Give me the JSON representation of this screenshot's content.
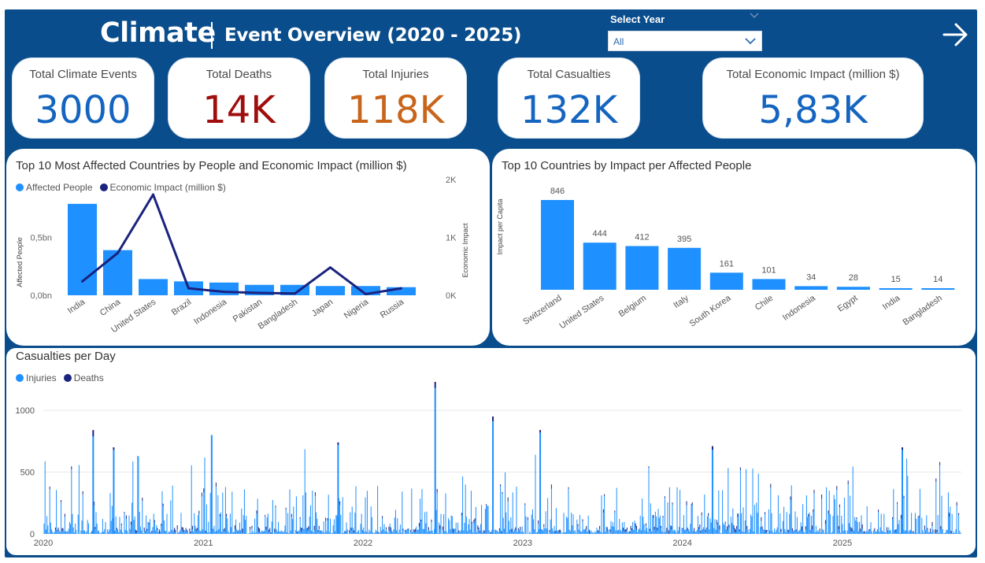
{
  "header": {
    "title": "Climate",
    "subtitle": "Event Overview (2020 - 2025)",
    "filter_label": "Select Year",
    "filter_value": "All",
    "nav_icon": "arrow-right-icon"
  },
  "colors": {
    "background": "#0a4d8c",
    "primary_bar": "#1e90ff",
    "dark_series": "#1a237e",
    "deaths_value": "#a00d0d",
    "injuries_value": "#c8651b",
    "blue_value": "#1565c0"
  },
  "kpis": [
    {
      "label": "Total Climate Events",
      "value": "3000",
      "color": "#1565c0"
    },
    {
      "label": "Total Deaths",
      "value": "14K",
      "color": "#a00d0d"
    },
    {
      "label": "Total Injuries",
      "value": "118K",
      "color": "#c8651b"
    },
    {
      "label": "Total Casualties",
      "value": "132K",
      "color": "#1565c0"
    },
    {
      "label": "Total Economic Impact (million $)",
      "value": "5,83K",
      "color": "#1565c0"
    }
  ],
  "chart_data": [
    {
      "type": "bar",
      "title": "Top 10 Most Affected Countries by People and Economic Impact (million $)",
      "categories": [
        "India",
        "China",
        "United States",
        "Brazil",
        "Indonesia",
        "Pakistan",
        "Bangladesh",
        "Japan",
        "Nigeria",
        "Russia"
      ],
      "series": [
        {
          "name": "Affected People",
          "type": "bar",
          "axis": "left",
          "values": [
            0.79,
            0.39,
            0.14,
            0.12,
            0.11,
            0.09,
            0.09,
            0.08,
            0.08,
            0.07
          ]
        },
        {
          "name": "Economic Impact (million $)",
          "type": "line",
          "axis": "right",
          "values": [
            240,
            730,
            1740,
            120,
            60,
            40,
            30,
            480,
            20,
            120
          ]
        }
      ],
      "ylabel": "Affected People",
      "ylabel_right": "Economic Impact",
      "y_ticks": [
        "0,0bn",
        "0,5bn"
      ],
      "y2_ticks": [
        "0K",
        "1K",
        "2K"
      ],
      "ylim": [
        0,
        1.0
      ],
      "y2lim": [
        0,
        2000
      ],
      "legend": "top-left"
    },
    {
      "type": "bar",
      "title": "Top 10 Countries by Impact per Affected People",
      "categories": [
        "Switzerland",
        "United States",
        "Belgium",
        "Italy",
        "South Korea",
        "Chile",
        "Indonesia",
        "Egypt",
        "India",
        "Bangladesh"
      ],
      "values": [
        846,
        444,
        412,
        395,
        161,
        101,
        34,
        28,
        15,
        14
      ],
      "ylabel": "Impact per Capita",
      "ylim": [
        0,
        846
      ]
    },
    {
      "type": "bar",
      "title": "Casualties per Day",
      "x_ticks": [
        "2020",
        "2021",
        "2022",
        "2023",
        "2024",
        "2025"
      ],
      "y_ticks": [
        "0",
        "500",
        "1000"
      ],
      "ylim": [
        0,
        1300
      ],
      "xlim": [
        "2020-01-01",
        "2025-09-30"
      ],
      "legend": "top-left",
      "series": [
        {
          "name": "Injuries",
          "color": "#1e90ff"
        },
        {
          "name": "Deaths",
          "color": "#1a237e"
        }
      ],
      "notable_peaks": [
        {
          "x": "2020-04-24",
          "injuries": 790,
          "deaths": 50
        },
        {
          "x": "2020-06-10",
          "injuries": 680,
          "deaths": 20
        },
        {
          "x": "2021-01-20",
          "injuries": 800,
          "deaths": 0
        },
        {
          "x": "2021-11-05",
          "injuries": 720,
          "deaths": 20
        },
        {
          "x": "2022-06-15",
          "injuries": 1180,
          "deaths": 50
        },
        {
          "x": "2022-10-25",
          "injuries": 910,
          "deaths": 40
        },
        {
          "x": "2023-02-10",
          "injuries": 820,
          "deaths": 20
        },
        {
          "x": "2024-03-10",
          "injuries": 680,
          "deaths": 30
        },
        {
          "x": "2025-05-18",
          "injuries": 680,
          "deaths": 20
        }
      ]
    }
  ]
}
